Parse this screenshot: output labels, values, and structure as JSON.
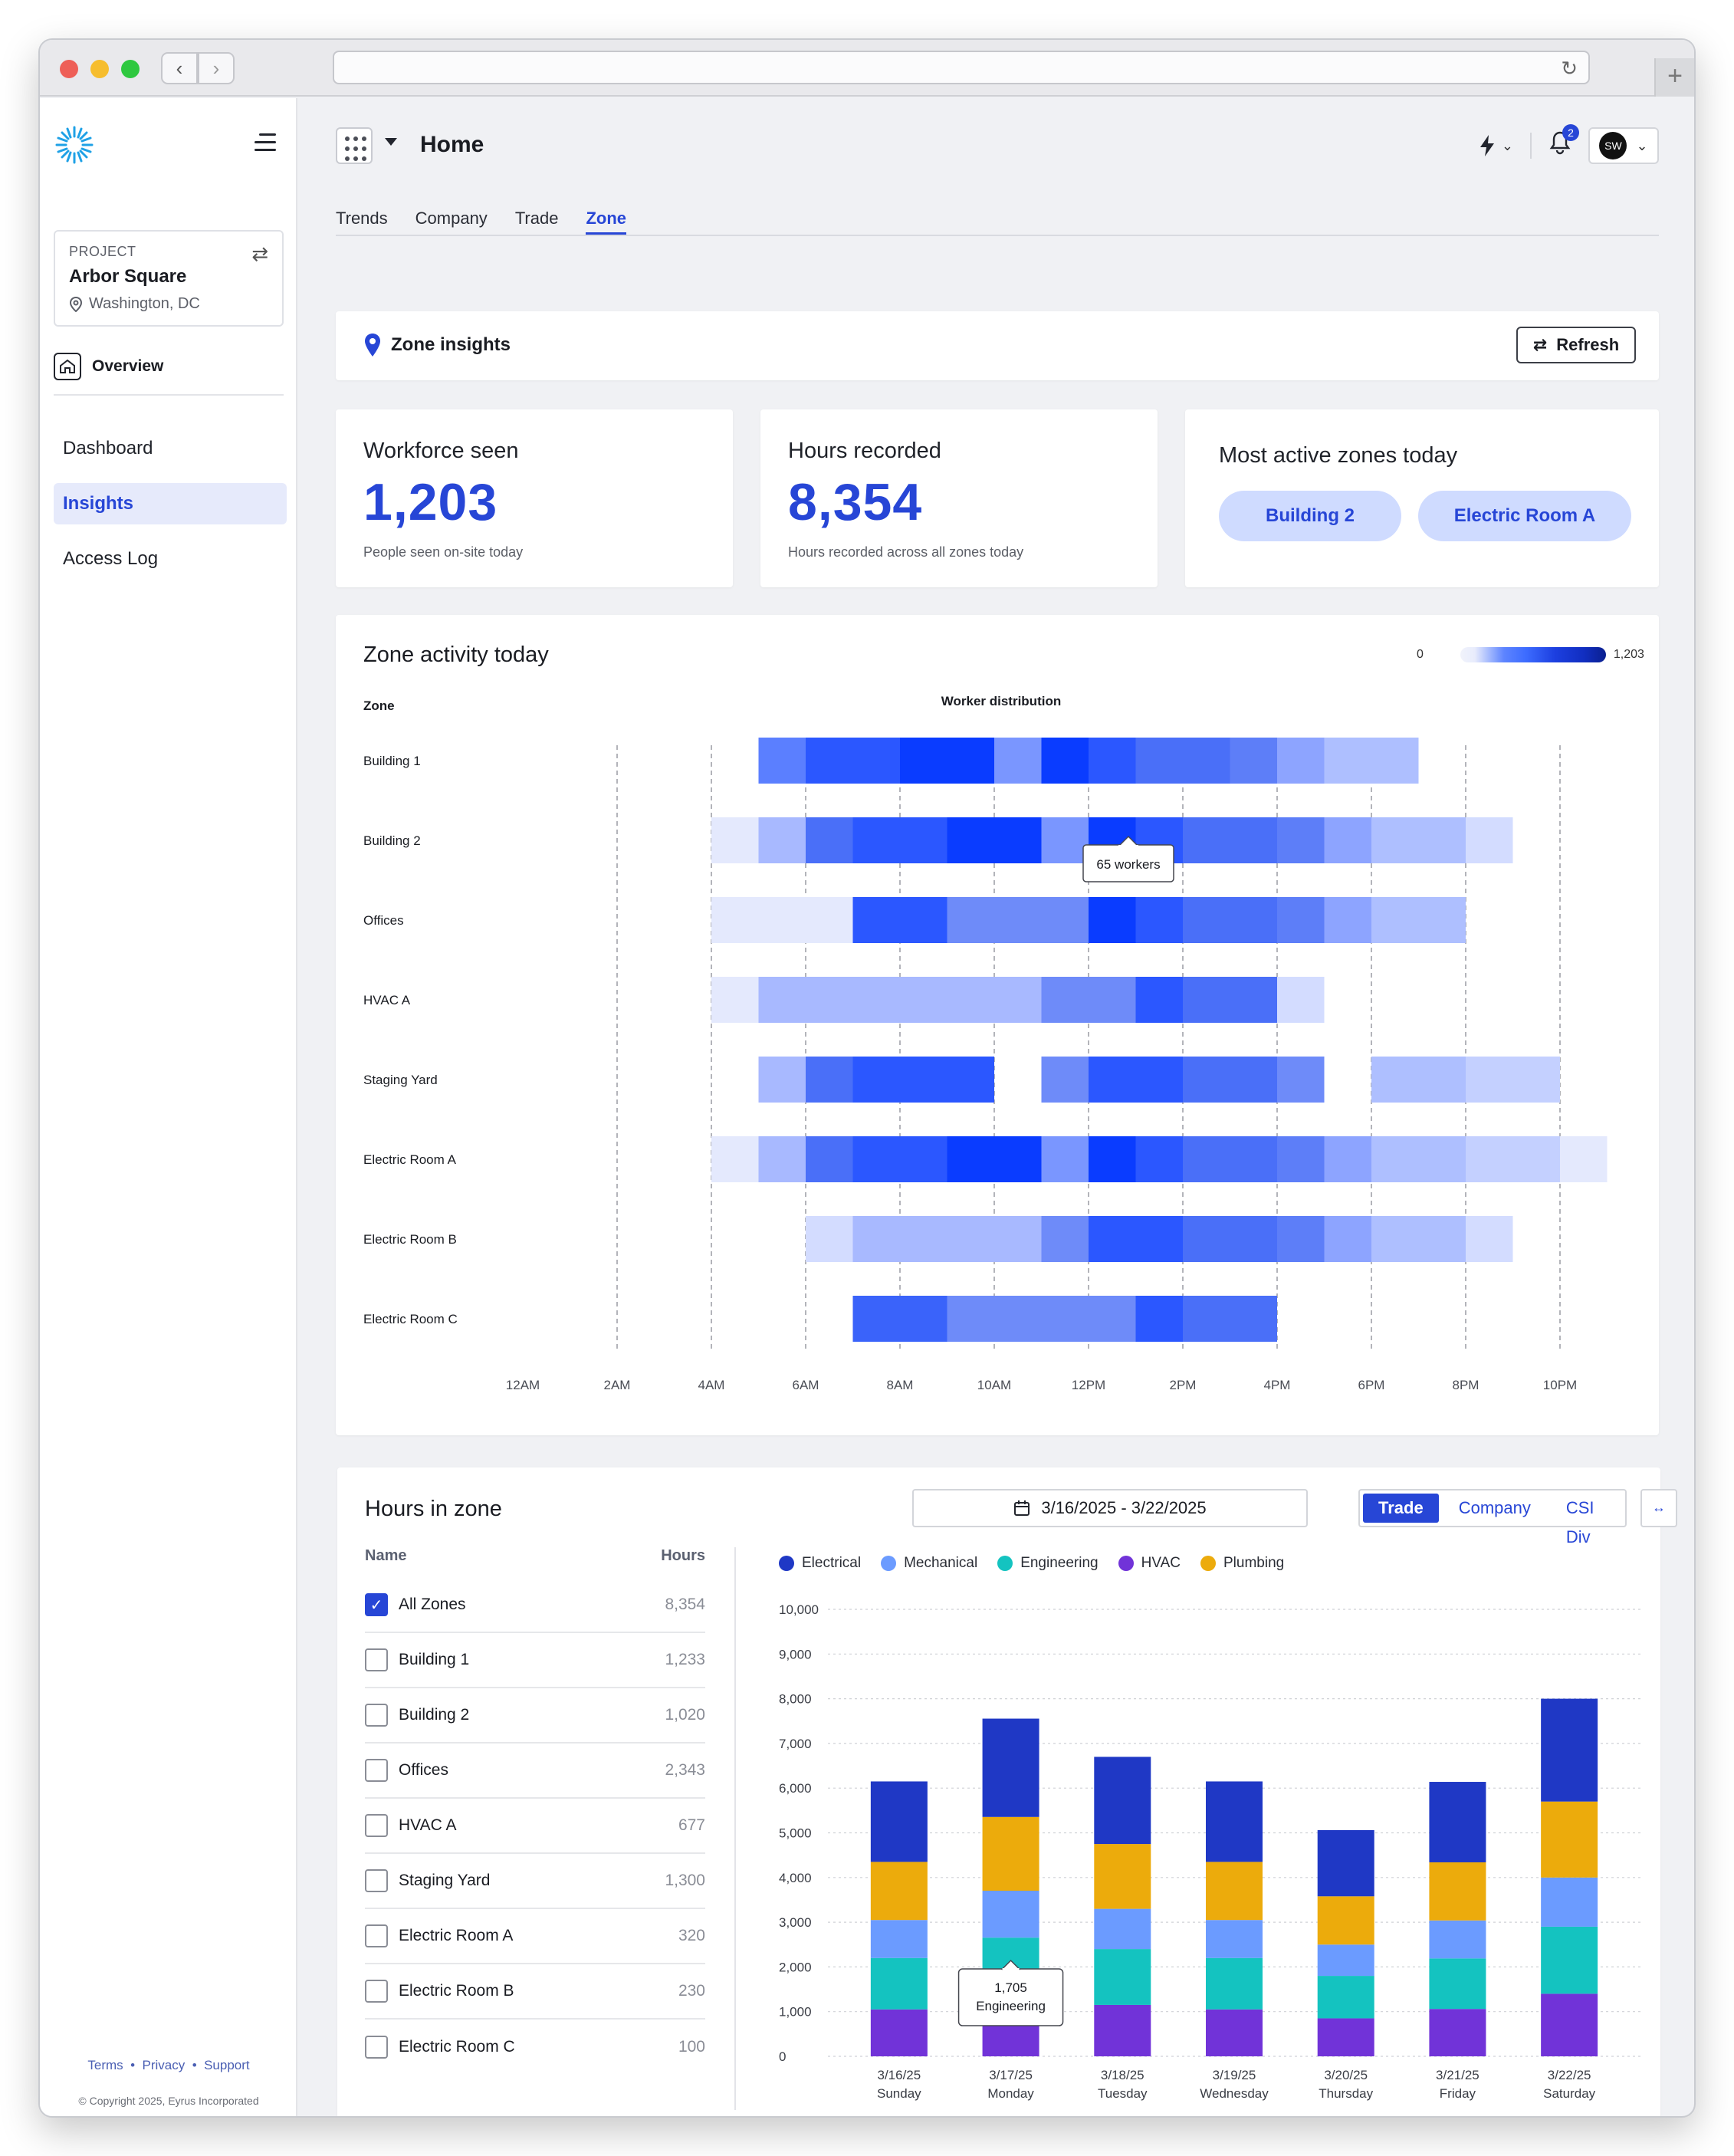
{
  "browser": {
    "reload_icon": "reload-icon",
    "new_tab_icon": "plus-icon"
  },
  "sidebar": {
    "project_label": "PROJECT",
    "project_name": "Arbor Square",
    "project_location": "Washington, DC",
    "overview": "Overview",
    "items": [
      {
        "label": "Dashboard",
        "active": false
      },
      {
        "label": "Insights",
        "active": true
      },
      {
        "label": "Access Log",
        "active": false
      }
    ],
    "footer": {
      "terms": "Terms",
      "privacy": "Privacy",
      "support": "Support",
      "sep": "•",
      "copyright": "© Copyright 2025, Eyrus Incorporated"
    }
  },
  "header": {
    "title": "Home",
    "notifications": "2",
    "avatar": "SW"
  },
  "tabs": [
    {
      "label": "Trends",
      "active": false
    },
    {
      "label": "Company",
      "active": false
    },
    {
      "label": "Trade",
      "active": false
    },
    {
      "label": "Zone",
      "active": true
    }
  ],
  "zone_insights": {
    "title": "Zone insights",
    "refresh": "Refresh"
  },
  "stats": {
    "workforce": {
      "title": "Workforce seen",
      "value": "1,203",
      "sub": "People seen on-site today"
    },
    "hours": {
      "title": "Hours recorded",
      "value": "8,354",
      "sub": "Hours recorded across all zones today"
    },
    "active": {
      "title": "Most active zones today",
      "zones": [
        "Building 2",
        "Electric Room A"
      ]
    }
  },
  "zone_activity": {
    "title": "Zone activity today",
    "scale_min": "0",
    "scale_max": "1,203",
    "col_zone": "Zone",
    "col_dist": "Worker distribution",
    "tooltip": "65 workers",
    "hours": [
      "12AM",
      "2AM",
      "4AM",
      "6AM",
      "8AM",
      "10AM",
      "12PM",
      "2PM",
      "4PM",
      "6PM",
      "8PM",
      "10PM"
    ],
    "zones": [
      {
        "name": "Building 1",
        "segments": [
          [
            5,
            6,
            "#5b7fff"
          ],
          [
            6,
            8,
            "#2b57ff"
          ],
          [
            8,
            10,
            "#0a3cff"
          ],
          [
            10,
            11,
            "#7a96ff"
          ],
          [
            11,
            12,
            "#0a3cff"
          ],
          [
            12,
            13,
            "#2b57ff"
          ],
          [
            13,
            15,
            "#4a6ff8"
          ],
          [
            15,
            16,
            "#5d7ef8"
          ],
          [
            16,
            17,
            "#8da4ff"
          ],
          [
            17,
            19,
            "#aebfff"
          ]
        ]
      },
      {
        "name": "Building 2",
        "segments": [
          [
            4,
            5,
            "#e4e9fd"
          ],
          [
            5,
            6,
            "#a8b9ff"
          ],
          [
            6,
            7,
            "#4a6ff8"
          ],
          [
            7,
            9,
            "#2b57ff"
          ],
          [
            9,
            11,
            "#0a3cff"
          ],
          [
            11,
            12,
            "#7a96ff"
          ],
          [
            12,
            13,
            "#0a3cff"
          ],
          [
            13,
            14,
            "#2b57ff"
          ],
          [
            14,
            16,
            "#4a6ff8"
          ],
          [
            16,
            17,
            "#5d7ef8"
          ],
          [
            17,
            18,
            "#8da4ff"
          ],
          [
            18,
            20,
            "#aebfff"
          ],
          [
            20,
            21,
            "#d3dcff"
          ]
        ]
      },
      {
        "name": "Offices",
        "segments": [
          [
            4,
            7,
            "#e4e9fd"
          ],
          [
            7,
            9,
            "#2b57ff"
          ],
          [
            9,
            12,
            "#6e8bf9"
          ],
          [
            12,
            13,
            "#0a3cff"
          ],
          [
            13,
            14,
            "#2b57ff"
          ],
          [
            14,
            16,
            "#4a6ff8"
          ],
          [
            16,
            17,
            "#5d7ef8"
          ],
          [
            17,
            18,
            "#8da4ff"
          ],
          [
            18,
            20,
            "#aebfff"
          ]
        ]
      },
      {
        "name": "HVAC A",
        "segments": [
          [
            4,
            5,
            "#e4e9fd"
          ],
          [
            5,
            11,
            "#a8b9ff"
          ],
          [
            11,
            13,
            "#6e8bf9"
          ],
          [
            13,
            14,
            "#2b57ff"
          ],
          [
            14,
            16,
            "#4a6ff8"
          ],
          [
            16,
            17,
            "#d3dcff"
          ]
        ]
      },
      {
        "name": "Staging Yard",
        "segments": [
          [
            5,
            6,
            "#a8b9ff"
          ],
          [
            6,
            7,
            "#4a6ff8"
          ],
          [
            7,
            10,
            "#2b57ff"
          ],
          [
            11,
            12,
            "#6e8bf9"
          ],
          [
            12,
            14,
            "#2b57ff"
          ],
          [
            14,
            16,
            "#4a6ff8"
          ],
          [
            16,
            17,
            "#6e8bf9"
          ],
          [
            18,
            20,
            "#aebfff"
          ],
          [
            20,
            22,
            "#c4d0ff"
          ]
        ]
      },
      {
        "name": "Electric Room A",
        "segments": [
          [
            4,
            5,
            "#e4e9fd"
          ],
          [
            5,
            6,
            "#a8b9ff"
          ],
          [
            6,
            7,
            "#4a6ff8"
          ],
          [
            7,
            9,
            "#2b57ff"
          ],
          [
            9,
            11,
            "#0a3cff"
          ],
          [
            11,
            12,
            "#7a96ff"
          ],
          [
            12,
            13,
            "#0a3cff"
          ],
          [
            13,
            14,
            "#2b57ff"
          ],
          [
            14,
            16,
            "#4a6ff8"
          ],
          [
            16,
            17,
            "#5d7ef8"
          ],
          [
            17,
            18,
            "#8da4ff"
          ],
          [
            18,
            20,
            "#aebfff"
          ],
          [
            20,
            22,
            "#c4d0ff"
          ],
          [
            22,
            23,
            "#e4e9fd"
          ]
        ]
      },
      {
        "name": "Electric Room B",
        "segments": [
          [
            6,
            7,
            "#d3dcff"
          ],
          [
            7,
            11,
            "#a8b9ff"
          ],
          [
            11,
            12,
            "#6e8bf9"
          ],
          [
            12,
            14,
            "#2b57ff"
          ],
          [
            14,
            16,
            "#4a6ff8"
          ],
          [
            16,
            17,
            "#5d7ef8"
          ],
          [
            17,
            18,
            "#8da4ff"
          ],
          [
            18,
            20,
            "#aebfff"
          ],
          [
            20,
            21,
            "#d3dcff"
          ]
        ]
      },
      {
        "name": "Electric Room C",
        "segments": [
          [
            7,
            9,
            "#3a63fa"
          ],
          [
            9,
            13,
            "#6e8bf9"
          ],
          [
            13,
            14,
            "#2b57ff"
          ],
          [
            14,
            16,
            "#4a6ff8"
          ]
        ]
      }
    ]
  },
  "hours_in_zone": {
    "title": "Hours in zone",
    "date_range": "3/16/2025 - 3/22/2025",
    "segments": [
      {
        "label": "Trade",
        "active": true
      },
      {
        "label": "Company",
        "active": false
      },
      {
        "label": "CSI Div",
        "active": false
      }
    ],
    "col_name": "Name",
    "col_hours": "Hours",
    "rows": [
      {
        "name": "All Zones",
        "hours": "8,354",
        "checked": true
      },
      {
        "name": "Building 1",
        "hours": "1,233",
        "checked": false
      },
      {
        "name": "Building 2",
        "hours": "1,020",
        "checked": false
      },
      {
        "name": "Offices",
        "hours": "2,343",
        "checked": false
      },
      {
        "name": "HVAC A",
        "hours": "677",
        "checked": false
      },
      {
        "name": "Staging Yard",
        "hours": "1,300",
        "checked": false
      },
      {
        "name": "Electric Room A",
        "hours": "320",
        "checked": false
      },
      {
        "name": "Electric Room B",
        "hours": "230",
        "checked": false
      },
      {
        "name": "Electric Room C",
        "hours": "100",
        "checked": false
      }
    ]
  },
  "chart_data": {
    "type": "bar",
    "stacked": true,
    "categories": [
      "3/16/25",
      "3/17/25",
      "3/18/25",
      "3/19/25",
      "3/20/25",
      "3/21/25",
      "3/22/25"
    ],
    "category_sublabels": [
      "Sunday",
      "Monday",
      "Tuesday",
      "Wednesday",
      "Thursday",
      "Friday",
      "Saturday"
    ],
    "ylim": [
      0,
      10000
    ],
    "yticks": [
      "0",
      "1,000",
      "2,000",
      "3,000",
      "4,000",
      "5,000",
      "6,000",
      "7,000",
      "8,000",
      "9,000",
      "10,000"
    ],
    "series": [
      {
        "name": "HVAC",
        "color": "#7133d8",
        "values": [
          1050,
          950,
          1150,
          1050,
          850,
          1060,
          1400
        ]
      },
      {
        "name": "Engineering",
        "color": "#14c3c0",
        "values": [
          1150,
          1705,
          1250,
          1150,
          950,
          1130,
          1500
        ]
      },
      {
        "name": "Mechanical",
        "color": "#6b9bff",
        "values": [
          850,
          1050,
          900,
          850,
          700,
          850,
          1100
        ]
      },
      {
        "name": "Plumbing",
        "color": "#ecab0c",
        "values": [
          1300,
          1650,
          1450,
          1300,
          1080,
          1300,
          1700
        ]
      },
      {
        "name": "Electrical",
        "color": "#1f38c5",
        "values": [
          1800,
          2200,
          1950,
          1800,
          1480,
          1800,
          2300
        ]
      }
    ],
    "legend_order": [
      "Electrical",
      "Mechanical",
      "Engineering",
      "HVAC",
      "Plumbing"
    ],
    "tooltip": {
      "value": "1,705",
      "series": "Engineering"
    }
  }
}
